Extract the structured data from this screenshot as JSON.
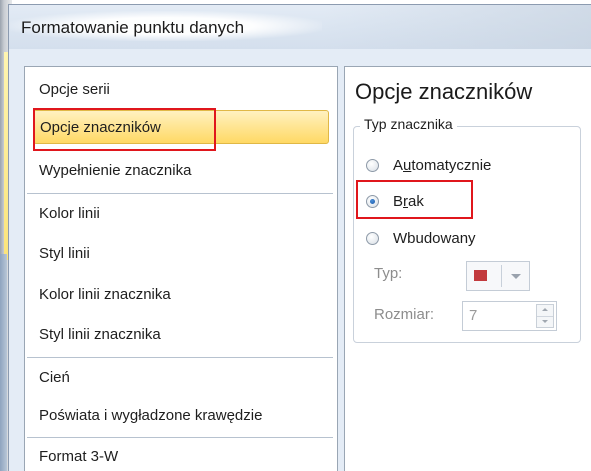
{
  "window": {
    "title": "Formatowanie punktu danych"
  },
  "sidebar": {
    "selected_index": 1,
    "items": [
      {
        "label": "Opcje serii"
      },
      {
        "label": "Opcje znaczników"
      },
      {
        "label": "Wypełnienie znacznika"
      },
      {
        "label": "Kolor linii"
      },
      {
        "label": "Styl linii"
      },
      {
        "label": "Kolor linii znacznika"
      },
      {
        "label": "Styl linii znacznika"
      },
      {
        "label": "Cień"
      },
      {
        "label": "Poświata i wygładzone krawędzie"
      },
      {
        "label": "Format 3-W"
      }
    ]
  },
  "content": {
    "section_title": "Opcje znaczników",
    "marker_type_group": {
      "legend": "Typ znacznika",
      "options": [
        {
          "label_pre": "A",
          "label_accel": "u",
          "label_post": "tomatycznie",
          "checked": false
        },
        {
          "label_pre": "B",
          "label_accel": "r",
          "label_post": "ak",
          "checked": true
        },
        {
          "label_pre": "Wbudowany",
          "label_accel": "",
          "label_post": "",
          "checked": false
        }
      ],
      "type_label": "Typ:",
      "type_swatch_color": "#c23a3d",
      "size_label": "Rozmiar:",
      "size_value": "7"
    }
  },
  "highlights": {
    "color": "#e0161c"
  }
}
